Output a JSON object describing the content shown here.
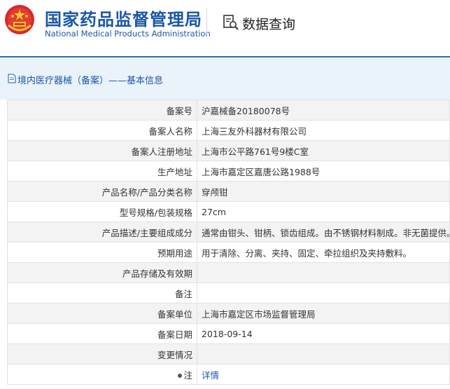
{
  "header": {
    "cn_title": "国家药品监督管理局",
    "en_title": "National Medical Products Administration",
    "query_title": "数据查询",
    "brand_color": "#1a56a8"
  },
  "breadcrumb": {
    "text": "境内医疗器械（备案）——基本信息"
  },
  "fields": [
    {
      "label": "备案号",
      "value": "沪嘉械备20180078号"
    },
    {
      "label": "备案人名称",
      "value": "上海三友外科器材有限公司"
    },
    {
      "label": "备案人注册地址",
      "value": "上海市公平路761号9楼C室"
    },
    {
      "label": "生产地址",
      "value": "上海市嘉定区嘉唐公路1988号"
    },
    {
      "label": "产品名称/产品分类名称",
      "value": "穿颅钳"
    },
    {
      "label": "型号规格/包装规格",
      "value": "27cm"
    },
    {
      "label": "产品描述/主要组成成分",
      "value": "通常由钳头、钳柄、锁齿组成。由不锈钢材料制成。非无菌提供。"
    },
    {
      "label": "预期用途",
      "value": "用于清除、分离、夹持、固定、牵拉组织及夹持敷料。"
    },
    {
      "label": "产品存储及有效期",
      "value": ""
    },
    {
      "label": "备注",
      "value": ""
    },
    {
      "label": "备案单位",
      "value": "上海市嘉定区市场监督管理局"
    },
    {
      "label": "备案日期",
      "value": "2018-09-14"
    },
    {
      "label": "变更情况",
      "value": ""
    }
  ],
  "note_row": {
    "label": "注",
    "link": "详情"
  }
}
